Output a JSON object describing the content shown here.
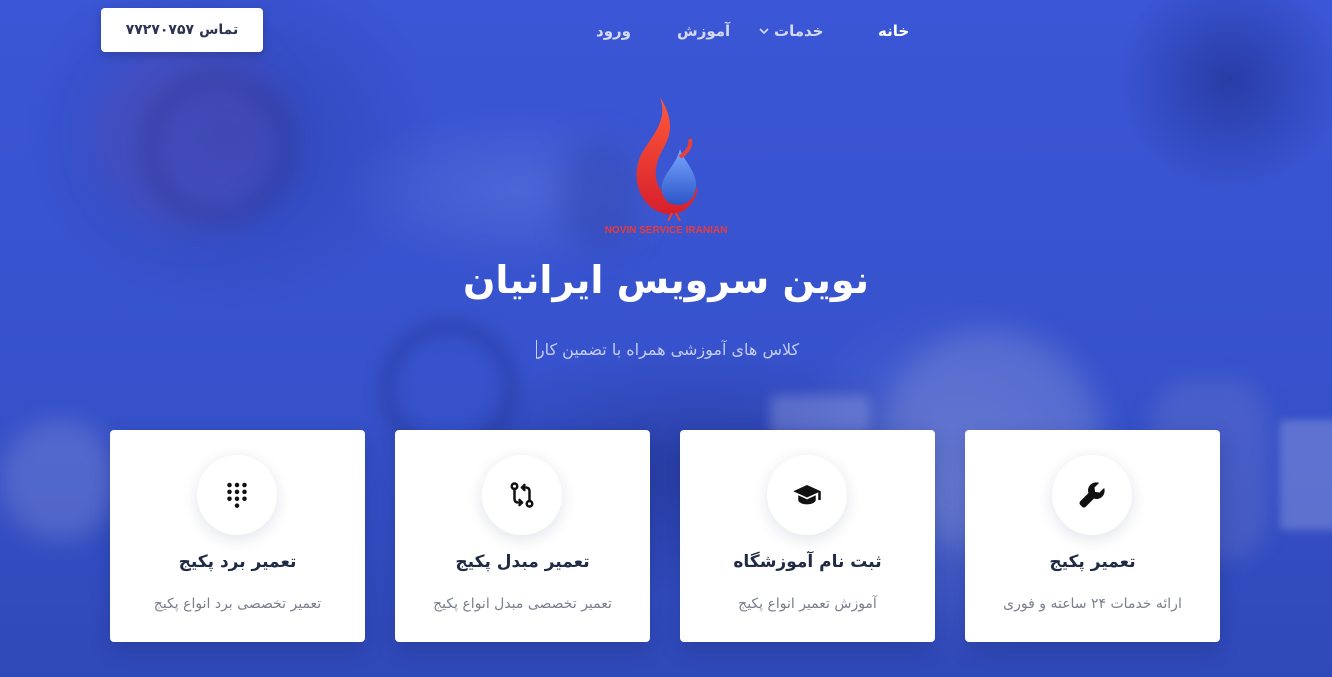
{
  "nav": {
    "call_label": "تماس",
    "call_number": "۷۷۲۷۰۷۵۷",
    "items": [
      {
        "label": "خانه",
        "active": true
      },
      {
        "label": "خدمات",
        "has_dropdown": true
      },
      {
        "label": "آموزش"
      },
      {
        "label": "ورود"
      }
    ]
  },
  "logo": {
    "text": "NOVIN SERVICE IRANIAN"
  },
  "hero": {
    "title": "نوین سرویس ایرانیان",
    "subtitle": "کلاس های آموزشی همراه با تضمین کار"
  },
  "cards": [
    {
      "icon": "wrench-icon",
      "title": "تعمیر پکیج",
      "description": "ارائه خدمات ۲۴ ساعته و فوری"
    },
    {
      "icon": "graduation-cap-icon",
      "title": "ثبت نام آموزشگاه",
      "description": "آموزش تعمیر انواع پکیج"
    },
    {
      "icon": "git-compare-icon",
      "title": "تعمیر مبدل پکیج",
      "description": "تعمیر تخصصی مبدل انواع پکیج"
    },
    {
      "icon": "dialpad-icon",
      "title": "تعمیر برد پکیج",
      "description": "تعمیر تخصصی برد انواع پکیج"
    }
  ],
  "colors": {
    "hero_background": "#3a55d4",
    "flame_red": "#e83c3c",
    "card_title": "#1f2a44"
  }
}
